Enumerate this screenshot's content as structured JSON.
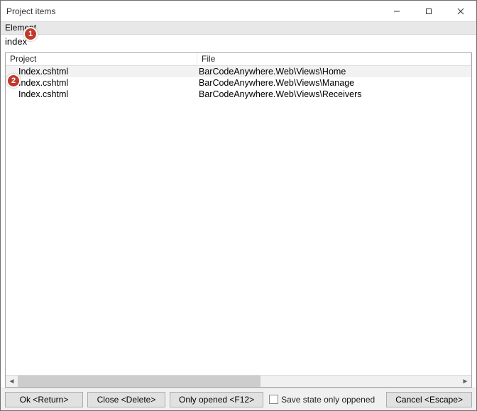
{
  "window": {
    "title": "Project items"
  },
  "search": {
    "label": "Element",
    "value": "index"
  },
  "columns": {
    "project": "Project",
    "file": "File"
  },
  "rows": [
    {
      "project": "Index.cshtml",
      "file": "BarCodeAnywhere.Web\\Views\\Home",
      "selected": true
    },
    {
      "project": "Index.cshtml",
      "file": "BarCodeAnywhere.Web\\Views\\Manage",
      "selected": false
    },
    {
      "project": "Index.cshtml",
      "file": "BarCodeAnywhere.Web\\Views\\Receivers",
      "selected": false
    }
  ],
  "footer": {
    "ok": "Ok <Return>",
    "close": "Close <Delete>",
    "only_opened": "Only opened <F12>",
    "save_state": "Save state only oppened",
    "cancel": "Cancel <Escape>"
  },
  "callouts": {
    "one": "1",
    "two": "2"
  }
}
